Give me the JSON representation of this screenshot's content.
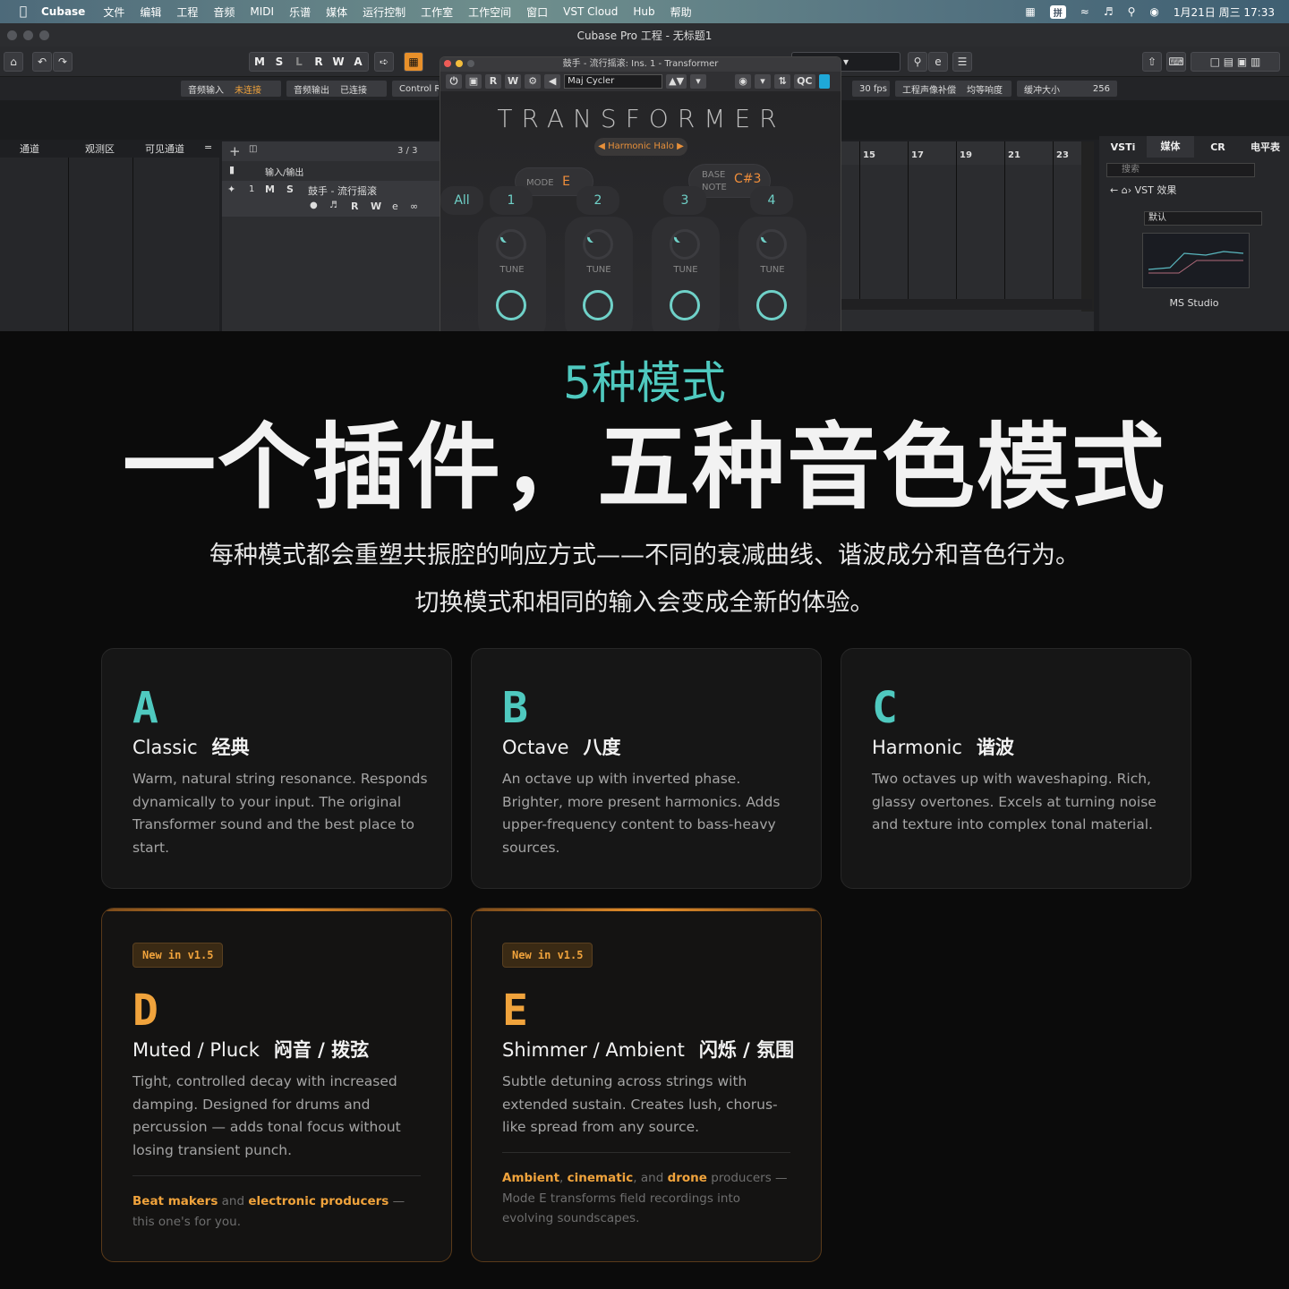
{
  "menubar": {
    "app": "Cubase",
    "items": [
      "文件",
      "编辑",
      "工程",
      "音频",
      "MIDI",
      "乐谱",
      "媒体",
      "运行控制",
      "工作室",
      "工作空间",
      "窗口",
      "VST Cloud",
      "Hub",
      "帮助"
    ],
    "ime": "拼",
    "clock": "1月21日 周三 17:33"
  },
  "window": {
    "title": "Cubase Pro 工程 - 无标题1"
  },
  "toolbar": {
    "transport_letters": [
      "M",
      "S",
      "L",
      "R",
      "W",
      "A"
    ]
  },
  "statusbar": {
    "audio_in": "音频输入",
    "audio_in_state": "未连接",
    "audio_out": "音频输出",
    "audio_out_state": "已连接",
    "control": "Control Ro",
    "fps": "30 fps",
    "latency_comp": "工程声像补偿",
    "latency_value": "均等响度",
    "buffer_label": "缓冲大小",
    "buffer_value": "256"
  },
  "left_panel": {
    "tabs": [
      "通道",
      "观测区",
      "可见通道",
      "="
    ]
  },
  "tracks": {
    "count": "3 / 3",
    "folder": "输入/输出",
    "track_number": "1",
    "track_name": "鼓手 - 流行摇滚",
    "track_buttons": [
      "M",
      "S"
    ],
    "track_buttons2": [
      "R",
      "W"
    ]
  },
  "ruler": {
    "bars": [
      "15",
      "17",
      "19",
      "21",
      "23"
    ]
  },
  "media": {
    "tabs": [
      "VSTi",
      "媒体",
      "CR",
      "电平表"
    ],
    "search_placeholder": "搜索",
    "crumb": "VST 效果",
    "preset": "默认",
    "device": "MS Studio"
  },
  "plugin": {
    "title": "鼓手 - 流行摇滚: Ins. 1 - Transformer",
    "bar_buttons": [
      "R",
      "W"
    ],
    "preset": "Maj Cycler",
    "qc": "QC",
    "logo": "TRANSFORMER",
    "halo": "Harmonic Halo",
    "mode_label": "MODE",
    "mode_value": "E",
    "base_label_1": "BASE",
    "base_label_2": "NOTE",
    "base_value": "C#3",
    "string_all": "All",
    "strings": [
      "1",
      "2",
      "3",
      "4"
    ],
    "knob_label": "TUNE"
  },
  "hero": {
    "kicker": "5种模式",
    "title": "一个插件，五种音色模式",
    "sub1": "每种模式都会重塑共振腔的响应方式——不同的衰减曲线、谐波成分和音色行为。",
    "sub2": "切换模式和相同的输入会变成全新的体验。"
  },
  "cards": [
    {
      "letter": "A",
      "name": "Classic",
      "zh": "经典",
      "color": "#4fc9bf",
      "desc": "Warm, natural string resonance. Responds dynamically to your input. The original Transformer sound and the best place to start."
    },
    {
      "letter": "B",
      "name": "Octave",
      "zh": "八度",
      "color": "#4fc9bf",
      "desc": "An octave up with inverted phase. Brighter, more present harmonics. Adds upper-frequency content to bass-heavy sources."
    },
    {
      "letter": "C",
      "name": "Harmonic",
      "zh": "谐波",
      "color": "#4fc9bf",
      "desc": "Two octaves up with waveshaping. Rich, glassy overtones. Excels at turning noise and texture into complex tonal material."
    },
    {
      "letter": "D",
      "name": "Muted / Pluck",
      "zh": "闷音 / 拨弦",
      "color": "#f0a33c",
      "badge": "New in v1.5",
      "desc": "Tight, controlled decay with increased damping. Designed for drums and percussion — adds tonal focus without losing transient punch.",
      "foot_hl1": "Beat makers",
      "foot_t1": " and ",
      "foot_hl2": "electronic producers",
      "foot_t2": " — this one's for you."
    },
    {
      "letter": "E",
      "name": "Shimmer / Ambient",
      "zh": "闪烁 / 氛围",
      "color": "#f0a33c",
      "badge": "New in v1.5",
      "desc": "Subtle detuning across strings with extended sustain. Creates lush, chorus-like spread from any source.",
      "foot_hl1": "Ambient",
      "foot_t0": ", ",
      "foot_hl2": "cinematic",
      "foot_t1": ", and ",
      "foot_hl3": "drone",
      "foot_t2": " producers — Mode E transforms field recordings into evolving soundscapes."
    }
  ],
  "colors": {
    "accent_teal": "#4fc9bf",
    "accent_orange": "#f0a33c",
    "background": "#0b0b0b"
  }
}
